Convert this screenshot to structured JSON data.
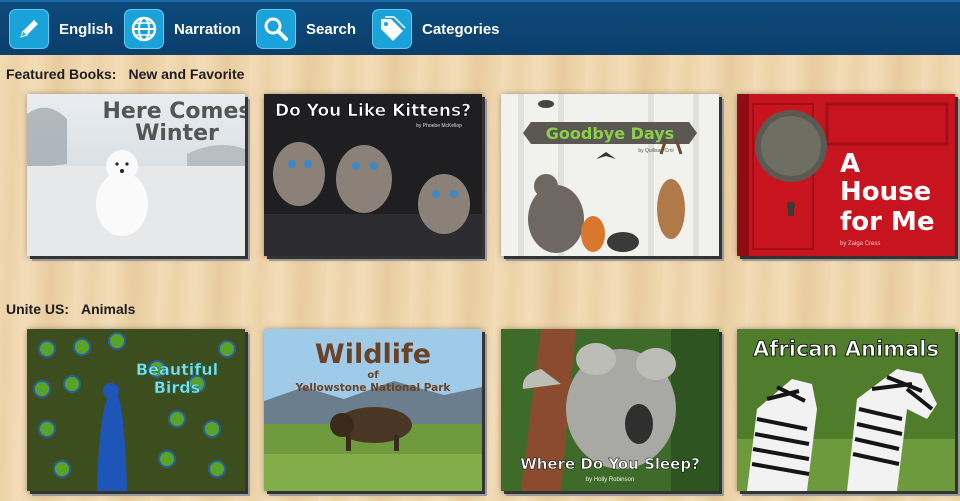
{
  "nav": {
    "items": [
      {
        "label": "English",
        "icon": "pencil-icon"
      },
      {
        "label": "Narration",
        "icon": "globe-icon"
      },
      {
        "label": "Search",
        "icon": "magnifier-icon"
      },
      {
        "label": "Categories",
        "icon": "tags-icon"
      }
    ]
  },
  "sections": [
    {
      "label": "Featured Books:",
      "sublabel": "New and Favorite",
      "books": [
        {
          "title_line1": "Here Comes",
          "title_line2": "Winter"
        },
        {
          "title": "Do You Like Kittens?",
          "byline": "by Phoebe McKellop"
        },
        {
          "title": "Goodbye Days",
          "byline": "by Quilisan Croi"
        },
        {
          "title_line1": "A",
          "title_line2": "House",
          "title_line3": "for Me",
          "byline": "by Zaiga Cress"
        }
      ]
    },
    {
      "label": "Unite US:",
      "sublabel": "Animals",
      "books": [
        {
          "title_line1": "Beautiful",
          "title_line2": "Birds"
        },
        {
          "title_line1": "Wildlife",
          "title_line2": "of",
          "title_line3": "Yellowstone National Park"
        },
        {
          "title": "Where Do You Sleep?",
          "byline": "by Holly Robinson"
        },
        {
          "title": "African Animals"
        }
      ]
    }
  ],
  "colors": {
    "nav_bg": "#0d4a7c",
    "nav_icon_bg": "#1aa3d9",
    "goodbye_title": "#8ad048",
    "house_red": "#c8141e"
  }
}
